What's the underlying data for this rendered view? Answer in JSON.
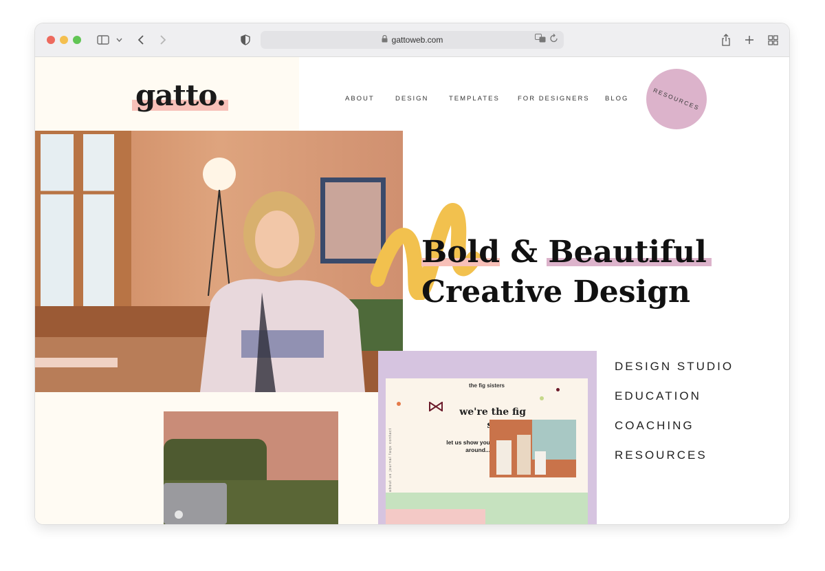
{
  "browser": {
    "url": "gattoweb.com"
  },
  "site": {
    "logo": "gatto.",
    "nav": [
      "ABOUT",
      "DESIGN",
      "TEMPLATES",
      "FOR DESIGNERS",
      "BLOG"
    ],
    "badge": "RESOURCES"
  },
  "hero": {
    "word1": "Bold",
    "amp": "&",
    "word2": "Beautiful",
    "line2": "Creative Design"
  },
  "mockup": {
    "title": "the fig sisters",
    "heading": "we're the fig sisters.",
    "subheading": "let us show you around...",
    "side_nav": "about us  journal  faqs  contact"
  },
  "links": [
    "DESIGN STUDIO",
    "EDUCATION",
    "COACHING",
    "RESOURCES"
  ],
  "colors": {
    "cream": "#fffbf3",
    "pink_highlight": "#f7c0b8",
    "lilac": "#dcb3cb",
    "mustard": "#f2c14e"
  }
}
